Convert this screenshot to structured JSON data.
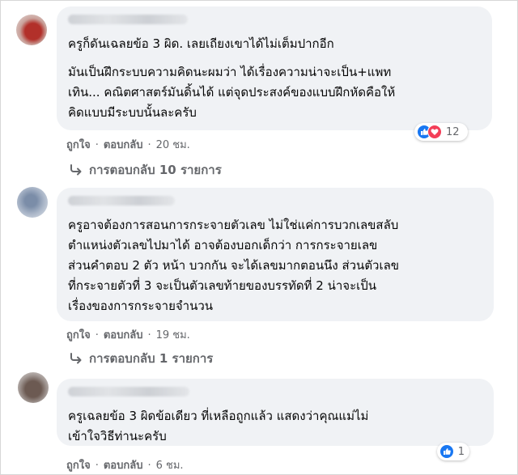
{
  "comments": [
    {
      "lines": [
        "ครูก็ดันเฉลยข้อ 3 ผิด. เลยเถียงเขาได้ไม่เต็มปากอีก",
        "มันเป็นฝึกระบบความคิดนะผมว่า ได้เรื่องความน่าจะเป็น+แพท",
        "เทิน... คณิตศาสตร์มันดิ้นได้ แต่จุดประสงค์ของแบบฝึกหัดคือให้",
        "คิดแบบมีระบบนั้นละครับ"
      ],
      "like_label": "ถูกใจ",
      "reply_label": "ตอบกลับ",
      "time": "20 ชม.",
      "reactions": {
        "icons": [
          "like-icon",
          "love-icon"
        ],
        "count": "12"
      },
      "replies_label": "การตอบกลับ 10 รายการ"
    },
    {
      "lines": [
        "ครูอาจต้องการสอนการกระจายตัวเลข ไม่ใช่แค่การบวกเลขสลับ",
        "ตำแหน่งตัวเลขไปมาได้ อาจต้องบอกเด็กว่า การกระจายเลข",
        "ส่วนคำตอบ 2 ตัว หน้า บวกกัน จะได้เลขมากตอนนึง ส่วนตัวเลข",
        "ที่กระจายตัวที่ 3 จะเป็นตัวเลขท้ายของบรรทัดที่ 2 น่าจะเป็น",
        "เรื่องของการกระจายจำนวน"
      ],
      "like_label": "ถูกใจ",
      "reply_label": "ตอบกลับ",
      "time": "19 ชม.",
      "replies_label": "การตอบกลับ 1 รายการ"
    },
    {
      "lines": [
        "ครูเฉลยข้อ 3 ผิดข้อเดียว ที่เหลือถูกแล้ว แสดงว่าคุณแม่ไม่",
        "เข้าใจวิธีท่านะครับ"
      ],
      "like_label": "ถูกใจ",
      "reply_label": "ตอบกลับ",
      "time": "6 ชม.",
      "reactions": {
        "icons": [
          "like-icon"
        ],
        "count": "1"
      }
    }
  ],
  "colors": {
    "bubble": "#f0f2f5",
    "meta": "#65676b",
    "like": "#1877f2",
    "love": "#f33e58"
  }
}
